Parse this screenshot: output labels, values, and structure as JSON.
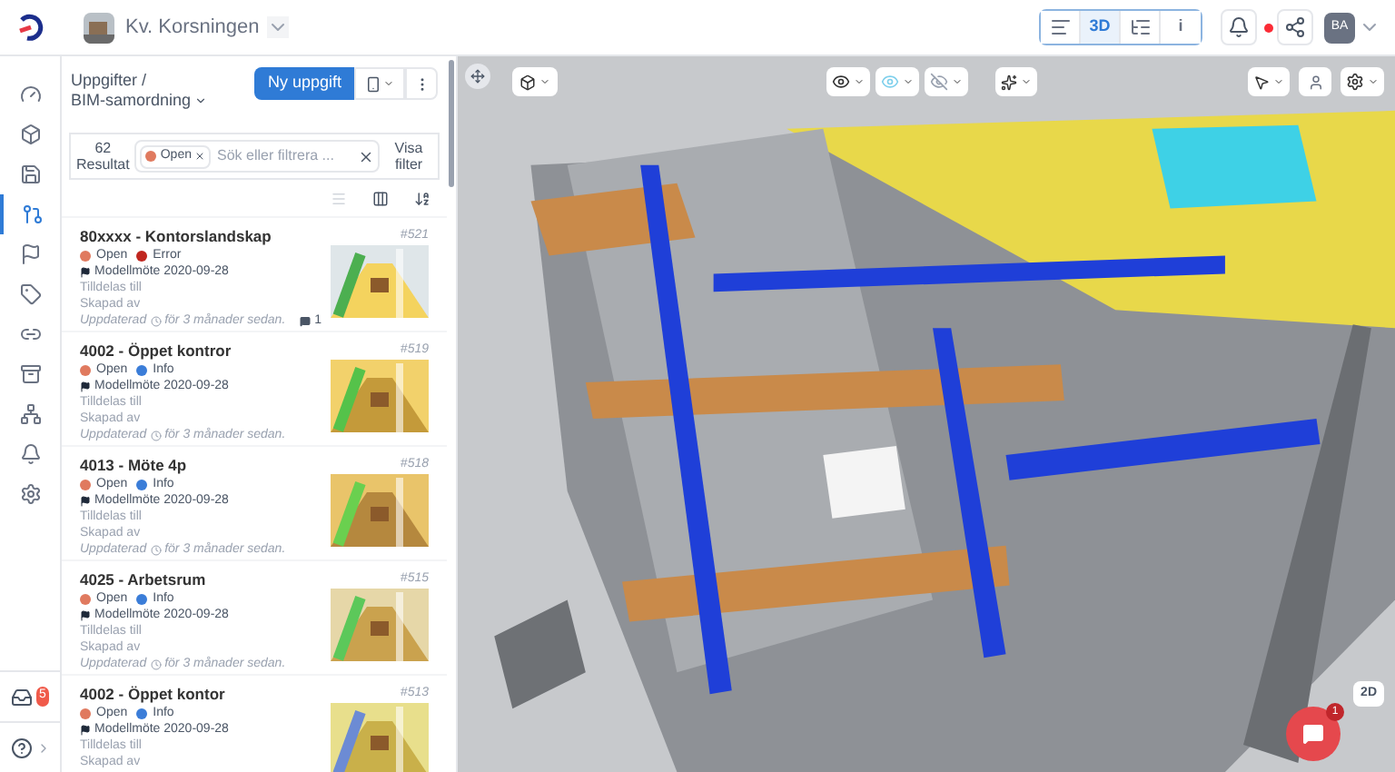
{
  "project": {
    "name": "Kv. Korsningen"
  },
  "nav": [
    {
      "kind": "gauge",
      "selected": false
    },
    {
      "kind": "cube",
      "selected": false
    },
    {
      "kind": "save",
      "selected": false
    },
    {
      "kind": "tasks",
      "selected": true
    },
    {
      "kind": "flag",
      "selected": false
    },
    {
      "kind": "tag",
      "selected": false
    },
    {
      "kind": "link",
      "selected": false
    },
    {
      "kind": "archive",
      "selected": false
    },
    {
      "kind": "network",
      "selected": false
    },
    {
      "kind": "bell",
      "selected": false
    },
    {
      "kind": "settings",
      "selected": false
    }
  ],
  "inbox": {
    "badge": "5"
  },
  "view_buttons": [
    {
      "kind": "list",
      "selected": false
    },
    {
      "kind": "text",
      "label": "3D",
      "selected": true
    },
    {
      "kind": "tree",
      "selected": false
    },
    {
      "kind": "text",
      "label": "i",
      "selected": false
    }
  ],
  "user": {
    "initials": "BA",
    "notification": true
  },
  "panel": {
    "breadcrumb": "Uppgifter /",
    "subtitle": "BIM-samordning",
    "new_button": "Ny uppgift",
    "count": "62",
    "count_label": "Resultat",
    "filter_chip": {
      "label": "Open",
      "color": "#e07a5f"
    },
    "search_placeholder": "Sök eller filtrera ...",
    "show_filter": "Visa filter"
  },
  "tasks": [
    {
      "title": "80xxxx - Kontorslandskap",
      "number": "#521",
      "status": {
        "label": "Open",
        "color": "#e07a5f"
      },
      "type": {
        "label": "Error",
        "color": "#c0261f"
      },
      "milestone": "Modellmöte 2020-09-28",
      "assigned": "Tilldelas till",
      "created": "Skapad av",
      "updated_label": "Uppdaterad",
      "updated": "för 3 månader sedan.",
      "comments": "1"
    },
    {
      "title": "4002 - Öppet kontror",
      "number": "#519",
      "status": {
        "label": "Open",
        "color": "#e07a5f"
      },
      "type": {
        "label": "Info",
        "color": "#3b7dd8"
      },
      "milestone": "Modellmöte 2020-09-28",
      "assigned": "Tilldelas till",
      "created": "Skapad av",
      "updated_label": "Uppdaterad",
      "updated": "för 3 månader sedan."
    },
    {
      "title": "4013 - Möte 4p",
      "number": "#518",
      "status": {
        "label": "Open",
        "color": "#e07a5f"
      },
      "type": {
        "label": "Info",
        "color": "#3b7dd8"
      },
      "milestone": "Modellmöte 2020-09-28",
      "assigned": "Tilldelas till",
      "created": "Skapad av",
      "updated_label": "Uppdaterad",
      "updated": "för 3 månader sedan."
    },
    {
      "title": "4025 - Arbetsrum",
      "number": "#515",
      "status": {
        "label": "Open",
        "color": "#e07a5f"
      },
      "type": {
        "label": "Info",
        "color": "#3b7dd8"
      },
      "milestone": "Modellmöte 2020-09-28",
      "assigned": "Tilldelas till",
      "created": "Skapad av",
      "updated_label": "Uppdaterad",
      "updated": "för 3 månader sedan."
    },
    {
      "title": "4002 - Öppet kontor",
      "number": "#513",
      "status": {
        "label": "Open",
        "color": "#e07a5f"
      },
      "type": {
        "label": "Info",
        "color": "#3b7dd8"
      },
      "milestone": "Modellmöte 2020-09-28",
      "assigned": "Tilldelas till",
      "created": "Skapad av"
    }
  ],
  "viewer": {
    "mode_button": "2D",
    "chat_badge": "1"
  }
}
